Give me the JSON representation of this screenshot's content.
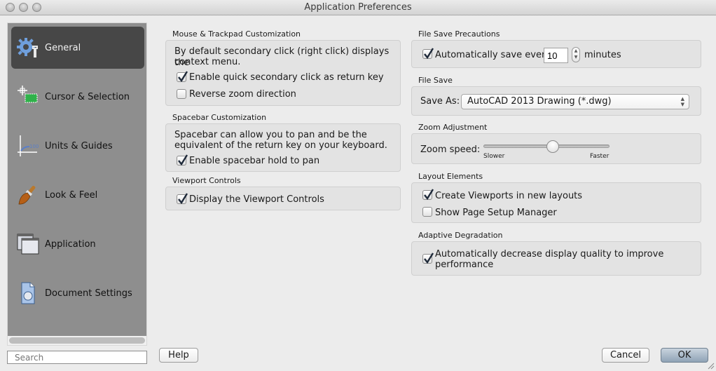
{
  "window": {
    "title": "Application Preferences"
  },
  "sidebar": {
    "items": [
      {
        "label": "General",
        "icon": "gear-wrench-icon",
        "active": true
      },
      {
        "label": "Cursor & Selection",
        "icon": "crosshair-selection-icon",
        "active": false
      },
      {
        "label": "Units & Guides",
        "icon": "ruler-guides-icon",
        "active": false
      },
      {
        "label": "Look & Feel",
        "icon": "paintbrush-icon",
        "active": false
      },
      {
        "label": "Application",
        "icon": "windows-icon",
        "active": false
      },
      {
        "label": "Document Settings",
        "icon": "document-settings-icon",
        "active": false
      }
    ],
    "search_placeholder": "Search"
  },
  "left_column": {
    "mouse": {
      "title": "Mouse & Trackpad Customization",
      "description_line1": "By default secondary click (right click) displays the",
      "description_line2": "context menu.",
      "options": [
        {
          "label": "Enable quick secondary click as return key",
          "checked": true
        },
        {
          "label": "Reverse zoom direction",
          "checked": false
        }
      ]
    },
    "spacebar": {
      "title": "Spacebar Customization",
      "description_line1": "Spacebar can allow you to pan and be the",
      "description_line2": "equivalent of the return key on your keyboard.",
      "options": [
        {
          "label": "Enable spacebar hold to pan",
          "checked": true
        }
      ]
    },
    "viewport": {
      "title": "Viewport Controls",
      "options": [
        {
          "label": "Display the Viewport Controls",
          "checked": true
        }
      ]
    }
  },
  "right_column": {
    "file_save_precautions": {
      "title": "File Save Precautions",
      "autosave_label": "Automatically save every",
      "autosave_checked": true,
      "autosave_value": "10",
      "autosave_unit": "minutes"
    },
    "file_save": {
      "title": "File Save",
      "save_as_label": "Save As:",
      "save_as_value": "AutoCAD 2013 Drawing (*.dwg)"
    },
    "zoom_adjustment": {
      "title": "Zoom Adjustment",
      "speed_label": "Zoom speed:",
      "min_label": "Slower",
      "max_label": "Faster",
      "value_fraction": 0.55
    },
    "layout_elements": {
      "title": "Layout Elements",
      "options": [
        {
          "label": "Create Viewports in new layouts",
          "checked": true
        },
        {
          "label": "Show Page Setup Manager",
          "checked": false
        }
      ]
    },
    "adaptive_degradation": {
      "title": "Adaptive Degradation",
      "label_line1": "Automatically decrease display quality to improve",
      "label_line2": "performance",
      "checked": true
    }
  },
  "footer": {
    "help_label": "Help",
    "cancel_label": "Cancel",
    "ok_label": "OK"
  }
}
